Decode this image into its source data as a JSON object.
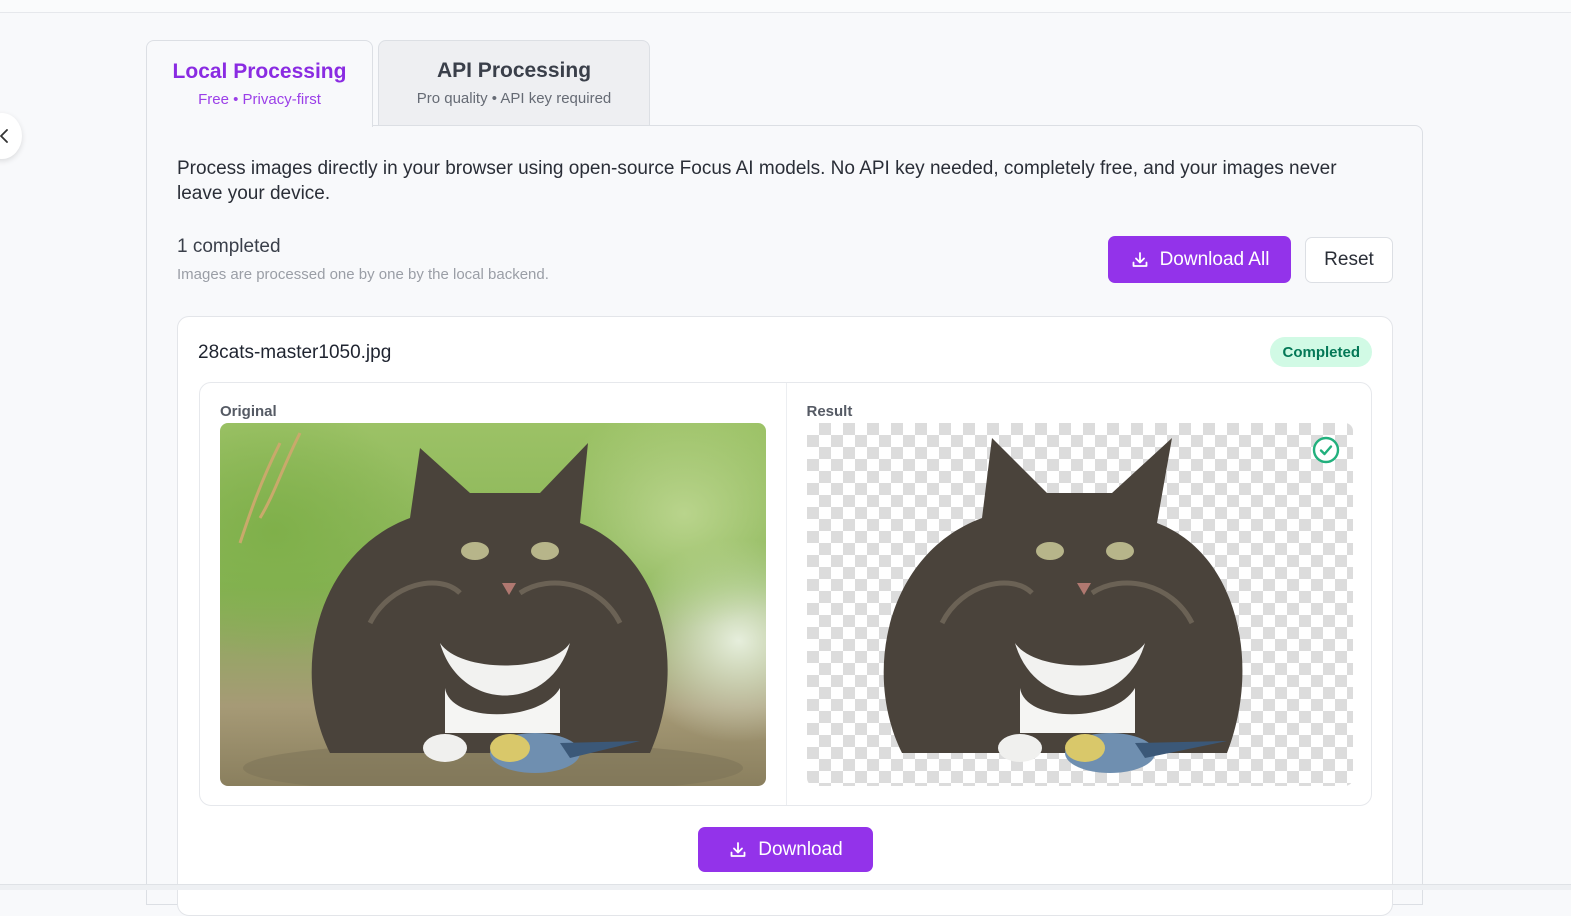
{
  "tabs": [
    {
      "title": "Local Processing",
      "subtitle": "Free • Privacy-first",
      "active": true
    },
    {
      "title": "API Processing",
      "subtitle": "Pro quality • API key required",
      "active": false
    }
  ],
  "intro": "Process images directly in your browser using open-source Focus AI models. No API key needed, completely free, and your images never leave your device.",
  "status": {
    "count_text": "1 completed",
    "note": "Images are processed one by one by the local backend."
  },
  "actions": {
    "download_all_label": "Download All",
    "reset_label": "Reset"
  },
  "item": {
    "filename": "28cats-master1050.jpg",
    "status_badge": "Completed",
    "original_label": "Original",
    "result_label": "Result",
    "download_label": "Download"
  },
  "colors": {
    "accent": "#9333ea",
    "accent_text": "#8a2be2",
    "success_bg": "#d1fae5",
    "success_text": "#047857",
    "success_icon": "#22b07d"
  },
  "icons": {
    "collapse": "chevron-left-icon",
    "download": "download-icon",
    "done": "check-circle-icon"
  }
}
